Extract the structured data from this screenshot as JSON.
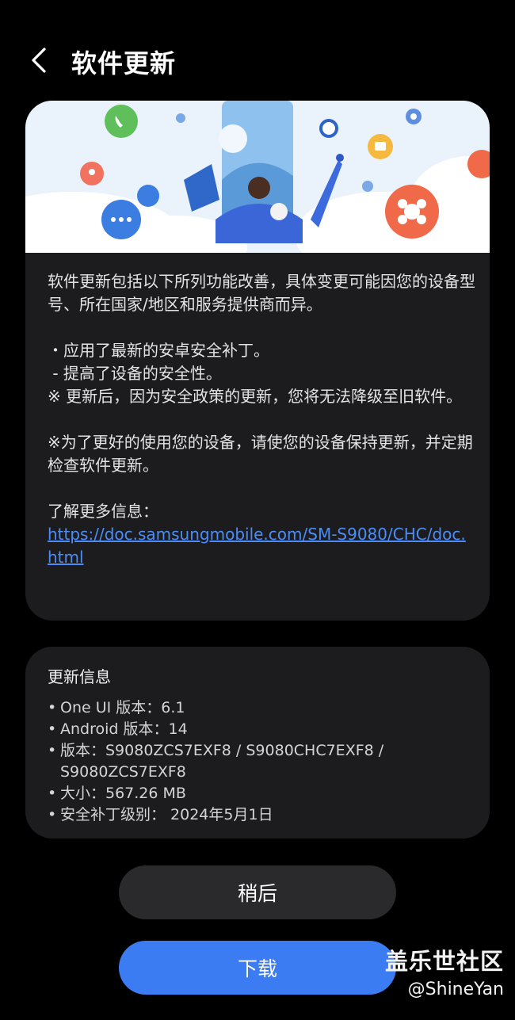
{
  "header": {
    "title": "软件更新",
    "back_icon": "chevron-left-icon"
  },
  "description": {
    "intro": "软件更新包括以下所列功能改善，具体变更可能因您的设备型号、所在国家/地区和服务提供商而异。",
    "bullet1": "・应用了最新的安卓安全补丁。",
    "bullet1_sub": " - 提高了设备的安全性。",
    "note1": "※ 更新后，因为安全政策的更新，您将无法降级至旧软件。",
    "note2": "※为了更好的使用您的设备，请使您的设备保持更新，并定期检查软件更新。",
    "more_label": "了解更多信息：",
    "link": "https://doc.samsungmobile.com/SM-S9080/CHC/doc.html"
  },
  "update_info": {
    "title": "更新信息",
    "items": [
      "One UI 版本：6.1",
      "Android 版本：14",
      "版本：S9080ZCS7EXF8 / S9080CHC7EXF8 / S9080ZCS7EXF8",
      "大小：567.26 MB",
      "安全补丁级别： 2024年5月1日"
    ],
    "bullet": "•"
  },
  "buttons": {
    "later": "稍后",
    "download": "下载"
  },
  "watermark": {
    "line1": "盖乐世社区",
    "line2": "@ShineYan"
  },
  "colors": {
    "accent": "#3c7cf2",
    "link": "#4a8df8",
    "card": "#1c1c1e"
  }
}
